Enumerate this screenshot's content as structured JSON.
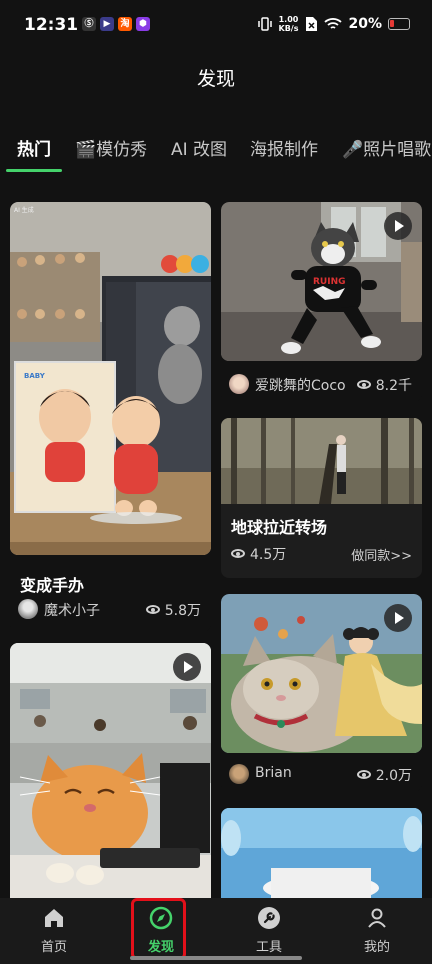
{
  "status_bar": {
    "time": "12:31",
    "net_speed_value": "1.00",
    "net_speed_unit": "KB/s",
    "battery": "20%",
    "app_icon_labels": [
      "Ⓢ",
      "▶",
      "淘",
      "⬢"
    ]
  },
  "header": {
    "title": "发现"
  },
  "tabs": [
    {
      "label": "热门",
      "active": true
    },
    {
      "label": "🎬模仿秀"
    },
    {
      "label": "AI 改图"
    },
    {
      "label": "海报制作"
    },
    {
      "label": "🎤照片唱歌"
    }
  ],
  "cards": {
    "c1": {
      "title": "变成手办",
      "author": "魔术小子",
      "views": "5.8万",
      "watermark": "AI 生成"
    },
    "c2": {
      "author": "爱跳舞的Coco",
      "views": "8.2千"
    },
    "c3": {
      "title": "地球拉近转场",
      "views": "4.5万",
      "action": "做同款>>"
    },
    "c4": {
      "author": "Brian",
      "views": "2.0万"
    }
  },
  "bottom_nav": [
    {
      "label": "首页",
      "icon": "home-icon"
    },
    {
      "label": "发现",
      "icon": "compass-icon",
      "active": true
    },
    {
      "label": "工具",
      "icon": "wrench-icon"
    },
    {
      "label": "我的",
      "icon": "user-icon"
    }
  ],
  "colors": {
    "accent": "#45d26b",
    "highlight": "#e3101a",
    "background": "#121212"
  }
}
